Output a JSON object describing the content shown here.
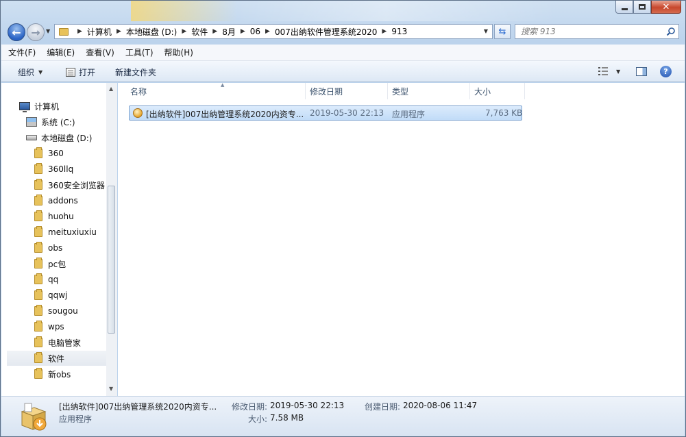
{
  "window": {
    "min_label": "",
    "max_label": "",
    "close_label": "✕"
  },
  "nav": {
    "breadcrumbs": [
      "计算机",
      "本地磁盘 (D:)",
      "软件",
      "8月",
      "06",
      "007出纳软件管理系统2020",
      "913"
    ],
    "search_placeholder": "搜索 913"
  },
  "menu": [
    "文件(F)",
    "编辑(E)",
    "查看(V)",
    "工具(T)",
    "帮助(H)"
  ],
  "toolbar": {
    "organize": "组织",
    "open": "打开",
    "new_folder": "新建文件夹",
    "help": "?"
  },
  "tree": {
    "computer": "计算机",
    "drives": [
      {
        "label": "系统 (C:)"
      },
      {
        "label": "本地磁盘 (D:)"
      }
    ],
    "folders": [
      "360",
      "360llq",
      "360安全浏览器",
      "addons",
      "huohu",
      "meituxiuxiu",
      "obs",
      "pc包",
      "qq",
      "qqwj",
      "sougou",
      "wps",
      "电脑管家",
      "软件",
      "新obs"
    ],
    "selected": "软件"
  },
  "columns": [
    "名称",
    "修改日期",
    "类型",
    "大小"
  ],
  "files": [
    {
      "name": "[出纳软件]007出纳管理系统2020内资专...",
      "modified": "2019-05-30 22:13",
      "type": "应用程序",
      "size": "7,763 KB"
    }
  ],
  "details": {
    "name": "[出纳软件]007出纳管理系统2020内资专...",
    "type": "应用程序",
    "modified_label": "修改日期:",
    "modified": "2019-05-30 22:13",
    "created_label": "创建日期:",
    "created": "2020-08-06 11:47",
    "size_label": "大小:",
    "size": "7.58 MB"
  }
}
